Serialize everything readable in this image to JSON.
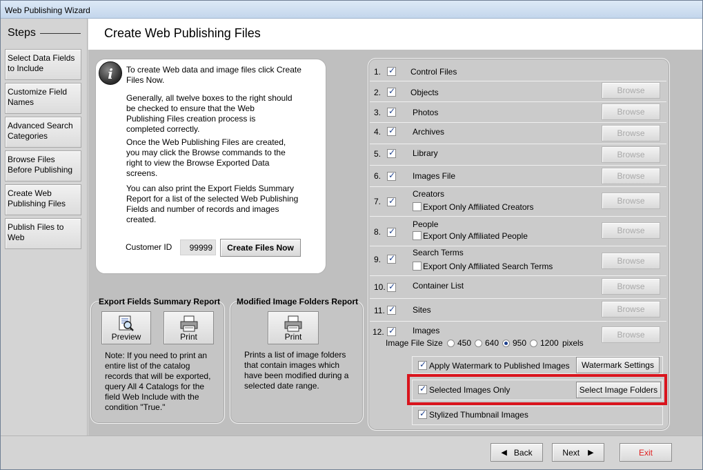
{
  "window": {
    "title": "Web Publishing Wizard"
  },
  "sidebar": {
    "heading": "Steps",
    "steps": [
      {
        "line1": "Select Data Fields",
        "line2": "to Include"
      },
      {
        "line1": "Customize Field",
        "line2": "Names"
      },
      {
        "line1": "Advanced Search",
        "line2": "Categories"
      },
      {
        "line1": "Browse Files",
        "line2": "Before Publishing"
      },
      {
        "line1": "Create Web",
        "line2": "Publishing Files"
      },
      {
        "line1": "Publish Files to",
        "line2": "Web"
      }
    ]
  },
  "header": {
    "title": "Create Web Publishing Files"
  },
  "info": {
    "icon": "info-icon",
    "p1": [
      "To create Web data and image files click Create",
      "Files Now."
    ],
    "p2": [
      "Generally, all twelve boxes to the right should",
      "be checked to ensure that the Web",
      "Publishing Files creation process is",
      "completed correctly."
    ],
    "p3": [
      "Once the Web Publishing Files are created,",
      "you may click the Browse commands to the",
      "right to view the Browse Exported Data",
      "screens."
    ],
    "p4": [
      "You can also print the Export Fields Summary",
      "Report for a list of the selected Web Publishing",
      "Fields and number of records and images",
      "created."
    ],
    "customer_id_label": "Customer ID",
    "customer_id": "99999",
    "create_button": "Create Files Now"
  },
  "export_panel": {
    "title": "Export Fields Summary Report",
    "preview_label": "Preview",
    "print_label": "Print",
    "note": [
      "Note: If you need to print an",
      "entire list of the catalog",
      "records that will be exported,",
      "query All 4 Catalogs for the",
      "field Web Include with the",
      "condition \"True.\""
    ]
  },
  "modified_panel": {
    "title": "Modified Image Folders Report",
    "print_label": "Print",
    "text": [
      "Prints a list of image folders",
      "that contain images which",
      "have been modified during a",
      "selected date range."
    ]
  },
  "files": {
    "browse_label": "Browse",
    "rows": [
      {
        "num": "1.",
        "label": "Control Files",
        "checked": true
      },
      {
        "num": "2.",
        "label": "Objects",
        "checked": true
      },
      {
        "num": "3.",
        "label": "Photos",
        "checked": true
      },
      {
        "num": "4.",
        "label": "Archives",
        "checked": true
      },
      {
        "num": "5.",
        "label": "Library",
        "checked": true
      },
      {
        "num": "6.",
        "label": "Images File",
        "checked": true
      },
      {
        "num": "7.",
        "label": "Creators",
        "checked": true,
        "sub": "Export Only Affiliated Creators"
      },
      {
        "num": "8.",
        "label": "People",
        "checked": true,
        "sub": "Export Only Affiliated People"
      },
      {
        "num": "9.",
        "label": "Search Terms",
        "checked": true,
        "sub": "Export Only Affiliated Search Terms"
      },
      {
        "num": "10.",
        "label": "Container List",
        "checked": true
      },
      {
        "num": "11.",
        "label": "Sites",
        "checked": true
      },
      {
        "num": "12.",
        "label": "Images",
        "checked": true
      }
    ],
    "image_size": {
      "label": "Image File Size",
      "options": [
        "450",
        "640",
        "950",
        "1200"
      ],
      "selected": "950",
      "unit": "pixels"
    },
    "watermark": {
      "label": "Apply Watermark to Published Images",
      "checked": true,
      "button": "Watermark Settings"
    },
    "selected_images": {
      "label": "Selected Images Only",
      "checked": true,
      "button": "Select Image Folders"
    },
    "thumbnail": {
      "label": "Stylized Thumbnail Images",
      "checked": true
    }
  },
  "footer": {
    "back": "Back",
    "next": "Next",
    "exit": "Exit"
  },
  "colors": {
    "highlight": "#d9141d",
    "exit_text": "#e02020"
  }
}
